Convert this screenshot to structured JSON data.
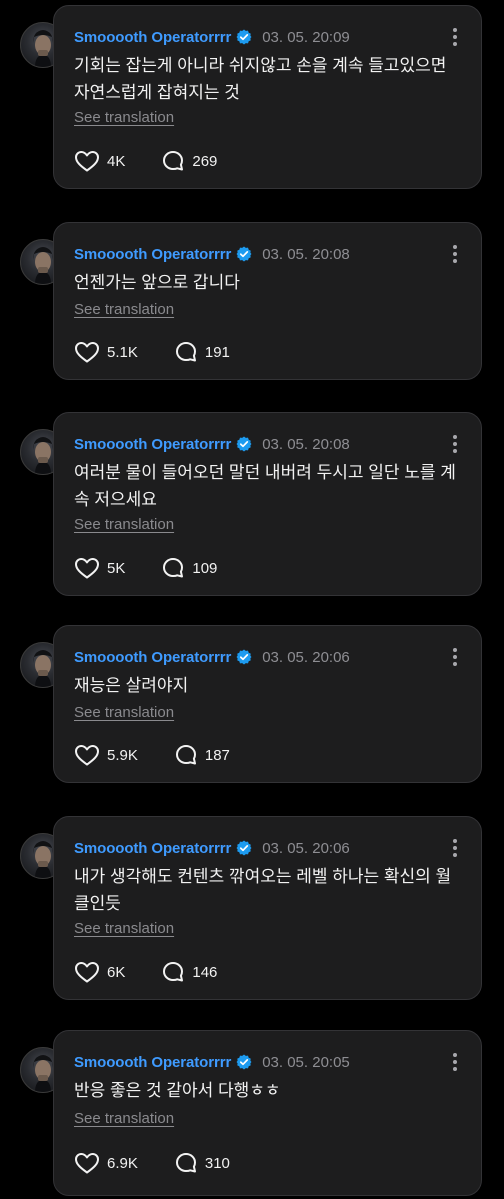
{
  "translate_label": "See translation",
  "accent_color": "#3f9bff",
  "posts": [
    {
      "username": "Smooooth Operatorrrr",
      "timestamp": "03. 05. 20:09",
      "text": "기회는 잡는게 아니라 쉬지않고 손을 계속 들고있으면 자연스럽게 잡혀지는 것",
      "likes": "4K",
      "comments": "269"
    },
    {
      "username": "Smooooth Operatorrrr",
      "timestamp": "03. 05. 20:08",
      "text": "언젠가는 앞으로 갑니다",
      "likes": "5.1K",
      "comments": "191"
    },
    {
      "username": "Smooooth Operatorrrr",
      "timestamp": "03. 05. 20:08",
      "text": "여러분 물이 들어오던 말던 내버려 두시고 일단 노를 계속 저으세요",
      "likes": "5K",
      "comments": "109"
    },
    {
      "username": "Smooooth Operatorrrr",
      "timestamp": "03. 05. 20:06",
      "text": "재능은 살려야지",
      "likes": "5.9K",
      "comments": "187"
    },
    {
      "username": "Smooooth Operatorrrr",
      "timestamp": "03. 05. 20:06",
      "text": "내가 생각해도 컨텐츠 깎여오는 레벨 하나는 확신의 월클인듯",
      "likes": "6K",
      "comments": "146"
    },
    {
      "username": "Smooooth Operatorrrr",
      "timestamp": "03. 05. 20:05",
      "text": "반응 좋은 것 같아서 다행ㅎㅎ",
      "likes": "6.9K",
      "comments": "310"
    }
  ]
}
